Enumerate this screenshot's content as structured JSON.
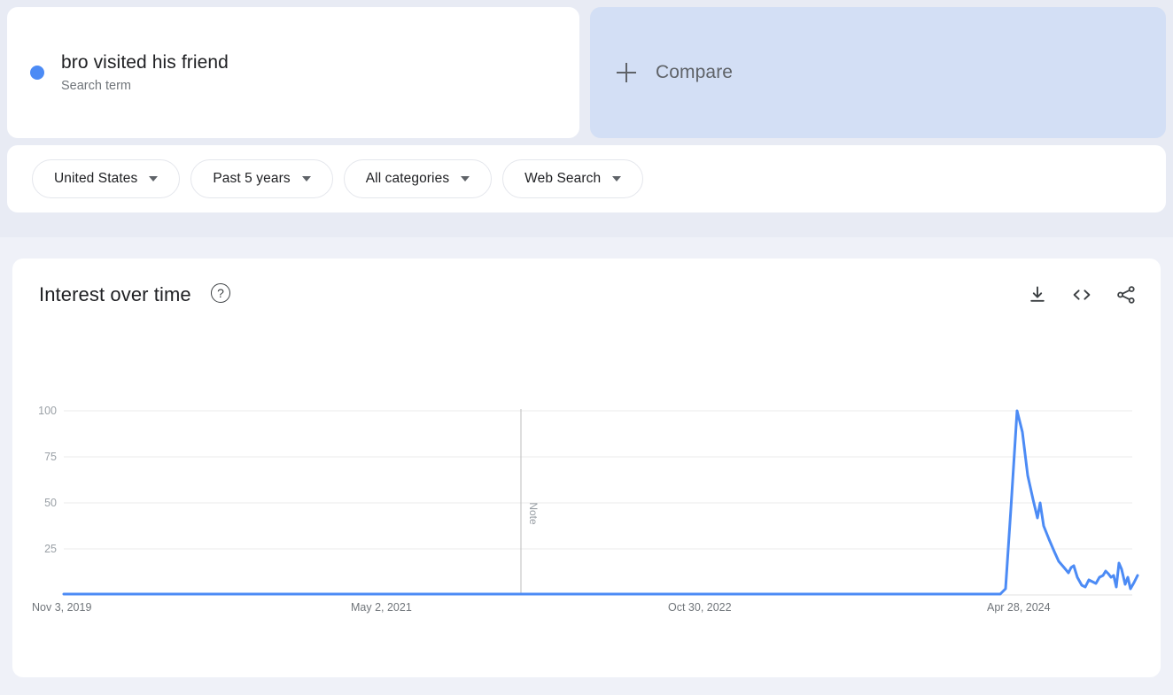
{
  "colors": {
    "series": "#4c8bf5",
    "page_bg_top": "#e8ebf4",
    "page_bg": "#eff1f8",
    "card_bg": "#ffffff",
    "compare_bg": "#d3dff5",
    "text_primary": "#202124",
    "text_secondary": "#70757a",
    "gridline": "#ebebeb"
  },
  "term_card": {
    "title": "bro visited his friend",
    "subtitle": "Search term",
    "dot_icon": "legend-dot-icon"
  },
  "compare": {
    "label": "Compare",
    "icon": "plus-icon"
  },
  "filters": [
    {
      "label": "United States",
      "icon": "chevron-down-icon"
    },
    {
      "label": "Past 5 years",
      "icon": "chevron-down-icon"
    },
    {
      "label": "All categories",
      "icon": "chevron-down-icon"
    },
    {
      "label": "Web Search",
      "icon": "chevron-down-icon"
    }
  ],
  "chart_panel": {
    "title": "Interest over time",
    "help_icon": "question-mark-icon",
    "help_glyph": "?",
    "actions": [
      {
        "name": "download-icon",
        "tooltip": "Download"
      },
      {
        "name": "embed-code-icon",
        "tooltip": "Embed"
      },
      {
        "name": "share-icon",
        "tooltip": "Share"
      }
    ]
  },
  "chart_data": {
    "type": "line",
    "title": "Interest over time",
    "xlabel": "",
    "ylabel": "",
    "ylim": [
      0,
      100
    ],
    "yticks": [
      100,
      75,
      50,
      25
    ],
    "xticks": [
      "Nov 3, 2019",
      "May 2, 2021",
      "Oct 30, 2022",
      "Apr 28, 2024"
    ],
    "xtick_positions": [
      0.0,
      0.3,
      0.6,
      0.9
    ],
    "grid": true,
    "legend_position": "none",
    "annotations": [
      {
        "label": "Note",
        "x_fraction": 0.4266,
        "orientation": "vertical",
        "line": true
      }
    ],
    "series": [
      {
        "name": "bro visited his friend",
        "color": "#4c8bf5",
        "x": [
          "Nov 3, 2019",
          "Apr 28, 2024 onward (weekly)"
        ],
        "values": [
          0,
          0,
          0,
          0,
          0,
          0,
          0,
          0,
          0,
          0,
          0,
          0,
          0,
          0,
          0,
          0,
          0,
          0,
          0,
          0,
          0,
          0,
          0,
          0,
          0,
          0,
          0,
          0,
          0,
          0,
          0,
          0,
          0,
          0,
          0,
          0,
          0,
          0,
          0,
          0,
          0,
          0,
          0,
          0,
          0,
          0,
          0,
          0,
          0,
          0,
          0,
          0,
          0,
          0,
          0,
          0,
          0,
          0,
          0,
          0,
          0,
          0,
          0,
          0,
          0,
          0,
          0,
          0,
          0,
          0,
          0,
          0,
          0,
          0,
          0,
          0,
          0,
          0,
          0,
          0,
          0,
          0,
          0,
          0,
          0,
          0,
          0,
          0,
          0,
          0,
          0,
          0,
          0,
          0,
          0,
          0,
          0,
          0,
          0,
          0,
          0,
          0,
          0,
          0,
          0,
          0,
          0,
          0,
          0,
          0,
          0,
          0,
          0,
          0,
          0,
          0,
          0,
          0,
          0,
          0,
          0,
          0,
          0,
          0,
          0,
          0,
          0,
          0,
          0,
          0,
          0,
          0,
          0,
          0,
          0,
          0,
          0,
          0,
          0,
          0,
          0,
          0,
          0,
          0,
          0,
          0,
          0,
          0,
          0,
          0,
          0,
          0,
          0,
          0,
          0,
          0,
          0,
          0,
          0,
          0,
          0,
          0,
          0,
          0,
          0,
          0,
          0,
          0,
          0,
          0,
          0,
          0,
          0,
          0,
          0,
          0,
          0,
          0,
          0,
          0,
          0,
          0,
          0,
          0,
          0,
          0,
          0,
          0,
          0,
          0,
          0,
          0,
          0,
          0,
          0,
          0,
          0,
          0,
          0,
          0,
          0,
          0,
          0,
          0,
          0,
          0,
          0,
          0,
          0,
          0,
          0,
          0,
          0,
          0,
          0,
          0,
          0,
          0,
          0,
          0,
          0,
          0,
          0,
          0,
          0,
          0,
          0,
          0,
          0,
          0,
          0,
          0,
          0,
          0,
          0,
          0,
          0,
          0,
          0,
          0,
          0,
          3,
          46,
          100,
          88,
          65,
          52,
          42,
          50,
          38,
          30,
          24,
          19,
          15,
          12,
          10,
          12,
          13,
          9,
          5,
          4,
          8,
          7,
          6,
          9,
          10,
          12,
          11,
          9,
          10,
          4,
          13,
          11,
          5,
          9,
          3,
          6,
          10
        ],
        "peak_value": 100,
        "peak_label": "Apr 28, 2024"
      }
    ]
  }
}
